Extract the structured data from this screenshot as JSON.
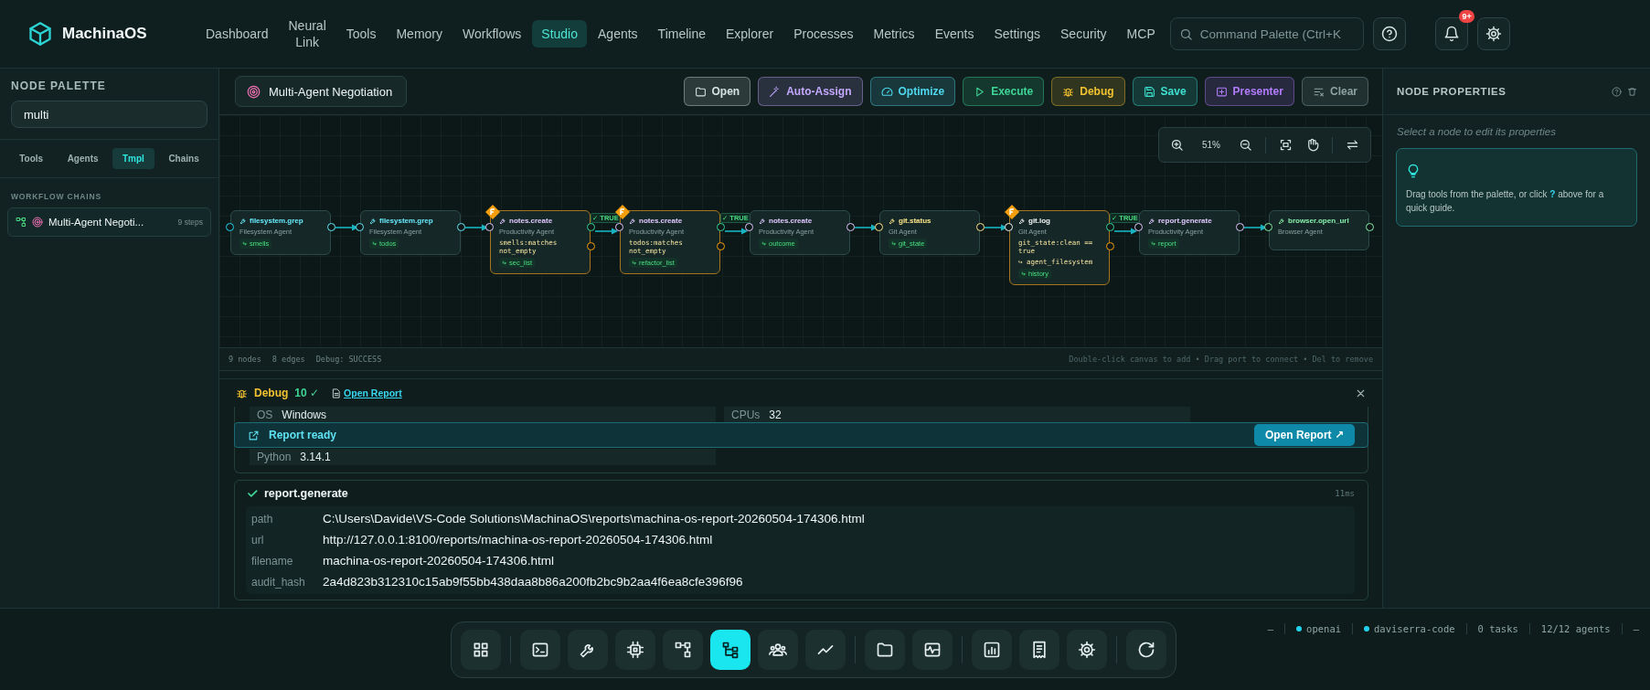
{
  "app": {
    "name": "MachinaOS"
  },
  "nav": [
    {
      "label": "Dashboard",
      "selected": false
    },
    {
      "label": "Neural\nLink",
      "selected": false
    },
    {
      "label": "Tools",
      "selected": false
    },
    {
      "label": "Memory",
      "selected": false
    },
    {
      "label": "Workflows",
      "selected": false
    },
    {
      "label": "Studio",
      "selected": true
    },
    {
      "label": "Agents",
      "selected": false
    },
    {
      "label": "Timeline",
      "selected": false
    },
    {
      "label": "Explorer",
      "selected": false
    },
    {
      "label": "Processes",
      "selected": false
    },
    {
      "label": "Metrics",
      "selected": false
    },
    {
      "label": "Events",
      "selected": false
    },
    {
      "label": "Settings",
      "selected": false
    },
    {
      "label": "Security",
      "selected": false
    },
    {
      "label": "MCP",
      "selected": false
    }
  ],
  "command_palette": {
    "placeholder": "Command Palette (Ctrl+K"
  },
  "notifications": {
    "badge": "9+"
  },
  "palette": {
    "title": "NODE PALETTE",
    "search": {
      "value": "multi"
    },
    "tabs": [
      {
        "label": "Tools",
        "selected": false
      },
      {
        "label": "Agents",
        "selected": false
      },
      {
        "label": "Tmpl",
        "selected": true
      },
      {
        "label": "Chains",
        "selected": false
      }
    ],
    "section": "WORKFLOW CHAINS",
    "items": [
      {
        "name": "Multi-Agent Negoti...",
        "steps": "9 steps"
      }
    ]
  },
  "workflow": {
    "title": "Multi-Agent Negotiation"
  },
  "toolbar": [
    {
      "label": "Open",
      "kind": "folder",
      "color": "#d6e2e2"
    },
    {
      "label": "Auto-Assign",
      "kind": "wand",
      "color": "#c4a8ff"
    },
    {
      "label": "Optimize",
      "kind": "gauge",
      "color": "#4fd8ee"
    },
    {
      "label": "Execute",
      "kind": "play",
      "color": "#3fd596"
    },
    {
      "label": "Debug",
      "kind": "bug",
      "color": "#f2c230"
    },
    {
      "label": "Save",
      "kind": "save",
      "color": "#3ee0d0"
    },
    {
      "label": "Presenter",
      "kind": "present",
      "color": "#b27cff"
    },
    {
      "label": "Clear",
      "kind": "clear",
      "color": "#8fa3a3"
    }
  ],
  "zoom": {
    "value": "51%"
  },
  "nodes": [
    {
      "title": "filesystem.grep",
      "agent": "Filesystem Agent",
      "tag": "smells",
      "color": "#67e8f9",
      "condition": false
    },
    {
      "title": "filesystem.grep",
      "agent": "Filesystem Agent",
      "tag": "todos",
      "color": "#67e8f9",
      "condition": false
    },
    {
      "title": "notes.create",
      "agent": "Productivity Agent",
      "lines": [
        "smells:matches not_empty"
      ],
      "tag": "sec_list",
      "color": "#e0c8ff",
      "condition": true
    },
    {
      "title": "notes.create",
      "agent": "Productivity Agent",
      "lines": [
        "todos:matches not_empty"
      ],
      "tag": "refactor_list",
      "color": "#e0c8ff",
      "condition": true
    },
    {
      "title": "notes.create",
      "agent": "Productivity Agent",
      "tag": "outcome",
      "color": "#e0c8ff",
      "condition": false
    },
    {
      "title": "git.status",
      "agent": "Git Agent",
      "tag": "git_state",
      "color": "#fde68a",
      "condition": false
    },
    {
      "title": "git.log",
      "agent": "Git Agent",
      "lines": [
        "git_state:clean == true",
        "↪ agent_filesystem"
      ],
      "tag": "history",
      "color": "#f1f5f5",
      "condition": true
    },
    {
      "title": "report.generate",
      "agent": "Productivity Agent",
      "tag": "report",
      "color": "#e0c8ff",
      "condition": false
    },
    {
      "title": "browser.open_url",
      "agent": "Browser Agent",
      "color": "#86efac",
      "condition": false
    }
  ],
  "edges": [
    {
      "kind": "plain"
    },
    {
      "kind": "plain"
    },
    {
      "kind": "labeled",
      "label": "✓ TRUE"
    },
    {
      "kind": "labeled",
      "label": "✓ TRUE"
    },
    {
      "kind": "plain"
    },
    {
      "kind": "plain"
    },
    {
      "kind": "labeled",
      "label": "✓ TRUE"
    },
    {
      "kind": "plain"
    }
  ],
  "canvas_status": {
    "stats": [
      "9 nodes",
      "8 edges",
      "Debug: SUCCESS"
    ],
    "hint": "Double-click canvas to add • Drag port to connect • Del to remove"
  },
  "debug": {
    "title": "Debug",
    "count": "10 ✓",
    "link": "Open Report",
    "system": [
      {
        "key": "OS",
        "value": "Windows"
      },
      {
        "key": "CPUs",
        "value": "32"
      },
      {
        "key": "Python",
        "value": "3.14.1"
      }
    ],
    "toast": {
      "text": "Report ready",
      "button": "Open Report ↗"
    },
    "steps": [
      {
        "name": "report.generate",
        "duration": "11ms",
        "fields": [
          {
            "key": "path",
            "value": "C:\\Users\\Davide\\VS-Code Solutions\\MachinaOS\\reports\\machina-os-report-20260504-174306.html"
          },
          {
            "key": "url",
            "value": "http://127.0.0.1:8100/reports/machina-os-report-20260504-174306.html"
          },
          {
            "key": "filename",
            "value": "machina-os-report-20260504-174306.html"
          },
          {
            "key": "audit_hash",
            "value": "2a4d823b312310c15ab9f55bb438daa8b86a200fb2bc9b2aa4f6ea8cfe396f96"
          }
        ]
      }
    ]
  },
  "properties": {
    "title": "NODE PROPERTIES",
    "hint": "Select a node to edit its properties",
    "tip": "Drag tools from the palette, or click **?** above for a quick guide."
  },
  "dock": {
    "groups": [
      [
        {
          "kind": "grid",
          "selected": false
        }
      ],
      [
        {
          "kind": "terminal",
          "selected": false
        },
        {
          "kind": "wrench",
          "selected": false
        },
        {
          "kind": "chip",
          "selected": false
        },
        {
          "kind": "hierarchy",
          "selected": false
        },
        {
          "kind": "tree",
          "selected": true
        },
        {
          "kind": "people",
          "selected": false
        },
        {
          "kind": "trend",
          "selected": false
        }
      ],
      [
        {
          "kind": "folder",
          "selected": false
        },
        {
          "kind": "pulse",
          "selected": false
        }
      ],
      [
        {
          "kind": "chart",
          "selected": false
        },
        {
          "kind": "receipt",
          "selected": false
        },
        {
          "kind": "gear",
          "selected": false
        }
      ],
      [
        {
          "kind": "refresh",
          "selected": false
        }
      ]
    ]
  },
  "status_bar": [
    {
      "text": "—",
      "kind": "plain"
    },
    {
      "text": "openai",
      "kind": "dot"
    },
    {
      "text": "daviserra-code",
      "kind": "dot"
    },
    {
      "text": "0 tasks",
      "kind": "plain"
    },
    {
      "text": "12/12 agents",
      "kind": "plain"
    },
    {
      "text": "—",
      "kind": "plain"
    }
  ]
}
